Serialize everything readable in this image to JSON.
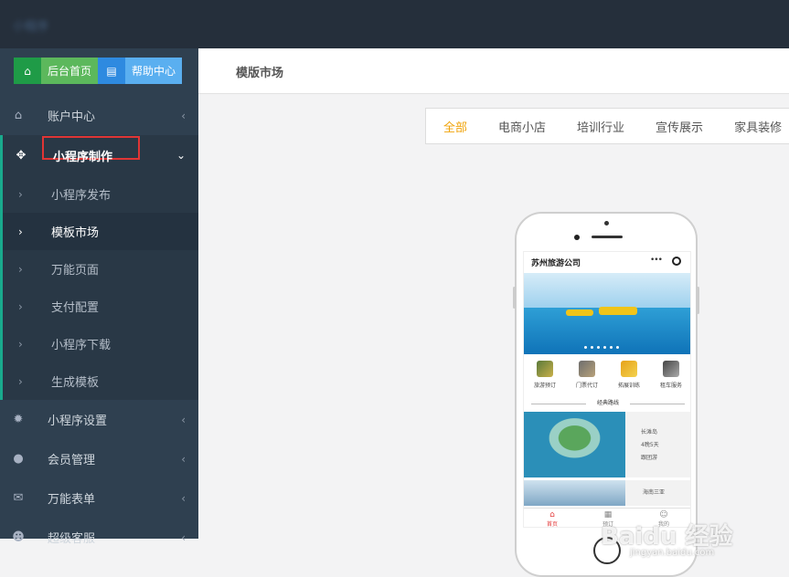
{
  "header": {
    "logo_text": "小程序"
  },
  "quick_buttons": [
    {
      "label": "后台首页",
      "icon": "home-icon"
    },
    {
      "label": "帮助中心",
      "icon": "book-icon"
    }
  ],
  "sidebar": {
    "items": [
      {
        "label": "账户中心",
        "icon": "home-icon"
      },
      {
        "label": "小程序制作",
        "icon": "move-icon"
      },
      {
        "label": "小程序设置",
        "icon": "gear-icon"
      },
      {
        "label": "会员管理",
        "icon": "user-icon"
      },
      {
        "label": "万能表单",
        "icon": "mail-icon"
      },
      {
        "label": "超级客服",
        "icon": "users-icon"
      }
    ],
    "submenu": [
      {
        "label": "小程序发布"
      },
      {
        "label": "模板市场",
        "active": true
      },
      {
        "label": "万能页面"
      },
      {
        "label": "支付配置"
      },
      {
        "label": "小程序下载"
      },
      {
        "label": "生成模板"
      }
    ]
  },
  "page": {
    "title": "模版市场"
  },
  "category_tabs": [
    {
      "label": "全部",
      "active": true
    },
    {
      "label": "电商小店"
    },
    {
      "label": "培训行业"
    },
    {
      "label": "宣传展示"
    },
    {
      "label": "家具装修"
    }
  ],
  "phone": {
    "app_title": "苏州旅游公司",
    "menu_dots": "•••",
    "icons": [
      {
        "label": "旅游预订"
      },
      {
        "label": "门票代订"
      },
      {
        "label": "拓展训练"
      },
      {
        "label": "租车服务"
      }
    ],
    "section_title": "经典路线",
    "card1_lines": [
      "长滩岛",
      "4晚5天",
      "跟团游"
    ],
    "card2_line": "海南三亚",
    "tabbar": [
      {
        "label": "首页",
        "glyph": "⌂"
      },
      {
        "label": "预订",
        "glyph": "▦"
      },
      {
        "label": "我的",
        "glyph": "☺"
      }
    ]
  },
  "watermark": {
    "main": "Baidu 经验",
    "sub": "jingyan.baidu.com"
  },
  "colors": {
    "sidebar": "#2f4050",
    "accent_green": "#19aa8d",
    "active_tab": "#f0a30a",
    "highlight_box": "#e03535"
  }
}
